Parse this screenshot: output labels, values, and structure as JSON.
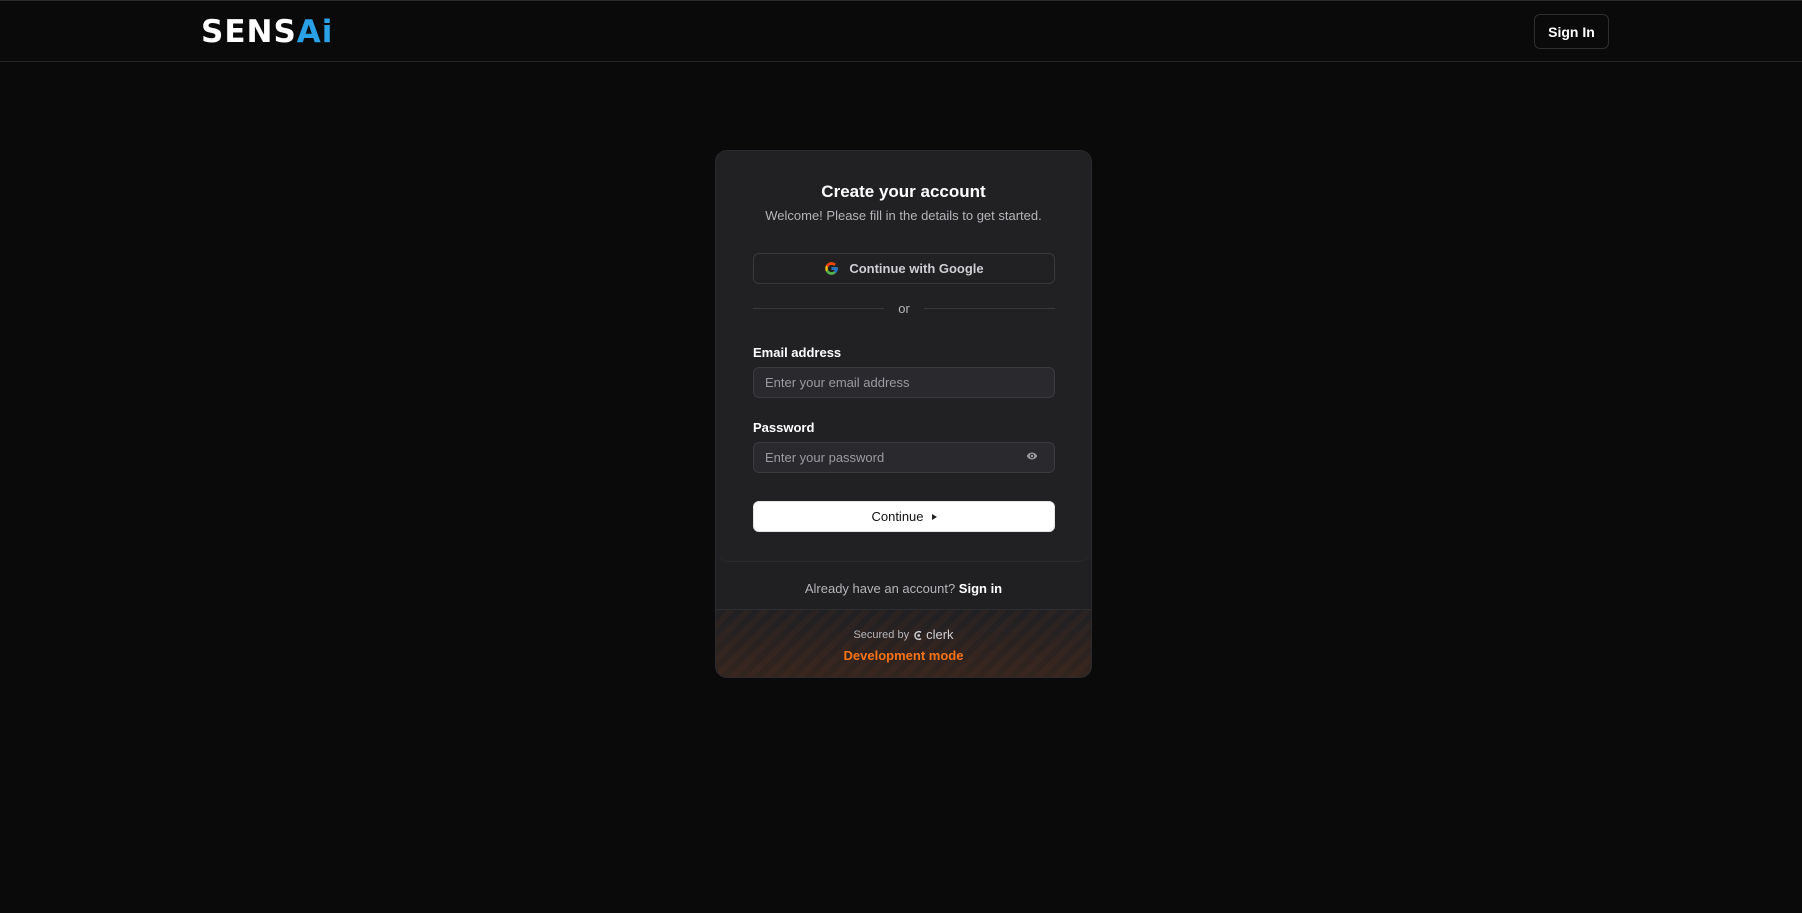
{
  "header": {
    "logo": {
      "part1": "SENS",
      "part2": "Ai"
    },
    "signin_label": "Sign In"
  },
  "card": {
    "title": "Create your account",
    "subtitle": "Welcome! Please fill in the details to get started.",
    "google_label": "Continue with Google",
    "divider_text": "or",
    "email": {
      "label": "Email address",
      "placeholder": "Enter your email address",
      "value": ""
    },
    "password": {
      "label": "Password",
      "placeholder": "Enter your password",
      "value": ""
    },
    "continue_label": "Continue",
    "footer": {
      "prompt": "Already have an account?",
      "link": "Sign in"
    },
    "secured": {
      "prefix": "Secured by",
      "brand": "clerk"
    },
    "dev_mode": "Development mode"
  },
  "icons": {
    "google": "google-icon",
    "eye": "eye-icon",
    "arrow": "play-arrow-icon",
    "clerk": "clerk-logo-icon"
  },
  "colors": {
    "background": "#0a0a0a",
    "card": "#212124",
    "logo_accent": "#2aa0e6",
    "dev_mode": "#f97316",
    "primary_button": "#ffffff"
  }
}
